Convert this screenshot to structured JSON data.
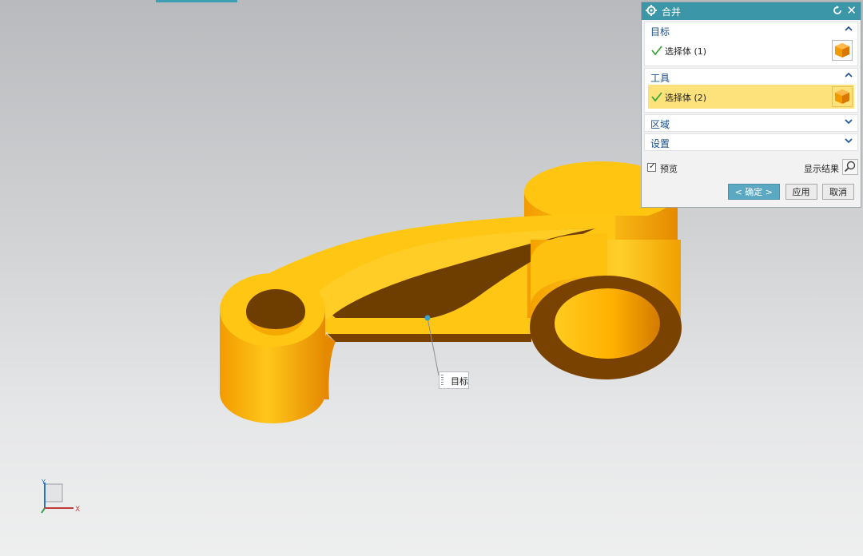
{
  "dialog": {
    "title": "合并",
    "target_group": {
      "label": "目标",
      "row_label": "选择体 (1)"
    },
    "tool_group": {
      "label": "工具",
      "row_label": "选择体 (2)"
    },
    "region_group": {
      "label": "区域"
    },
    "settings_group": {
      "label": "设置"
    },
    "preview_label": "预览",
    "preview_checked": true,
    "show_result_label": "显示结果",
    "ok_label": "< 确定 >",
    "apply_label": "应用",
    "cancel_label": "取消"
  },
  "viewport": {
    "callout_label": "目标",
    "triad": {
      "x_label": "X",
      "y_label": "Y"
    }
  },
  "colors": {
    "model_light": "#ffc714",
    "model_dark": "#7a4200",
    "accent": "#3b96a8",
    "selection": "#fde17a"
  }
}
